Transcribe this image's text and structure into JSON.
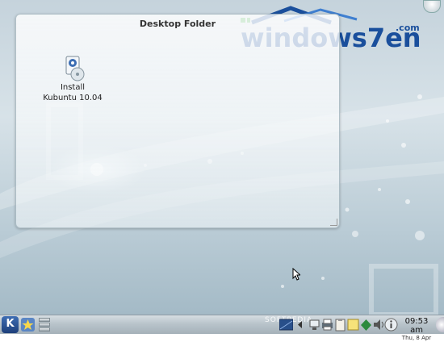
{
  "folder": {
    "title": "Desktop Folder"
  },
  "icons": [
    {
      "label_line1": "Install",
      "label_line2": "Kubuntu 10.04"
    }
  ],
  "watermark": {
    "text": "windows7en",
    "suffix": ".com"
  },
  "panel": {
    "kickoff_label": "K",
    "softpedia_text": "SOFTPEDIA",
    "clock_time": "09:53 am",
    "clock_date": "Thu, 8 Apr"
  },
  "colors": {
    "panel": "#b9c4cb",
    "kmenu": "#2b5394",
    "watermark": "#1a4f9c",
    "watermark_accent": "#2fa33b"
  }
}
